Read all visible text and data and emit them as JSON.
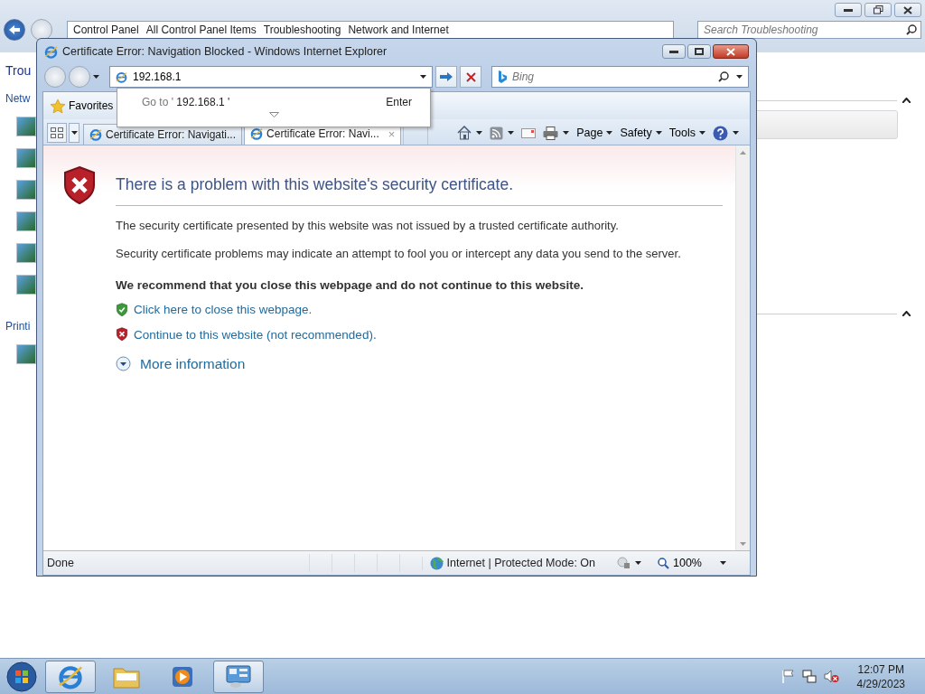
{
  "explorer_window": {
    "breadcrumb": [
      "Control Panel",
      "All Control Panel Items",
      "Troubleshooting",
      "Network and Internet"
    ],
    "search": {
      "placeholder": "Search Troubleshooting"
    },
    "heading": "Trou",
    "sections": [
      {
        "label": "Netw"
      },
      {
        "label": "Printi"
      }
    ]
  },
  "ie_window": {
    "title": "Certificate Error: Navigation Blocked - Windows Internet Explorer",
    "address": {
      "value": "192.168.1"
    },
    "search": {
      "placeholder": "Bing"
    },
    "suggestion": {
      "prefix": "Go to '",
      "text": "192.168.1 '",
      "shortcut": "Enter"
    },
    "favorites": "Favorites",
    "tabs": [
      {
        "label": "Certificate Error: Navigati...",
        "selected": false
      },
      {
        "label": "Certificate Error: Navi...",
        "selected": true,
        "close": "×"
      }
    ],
    "menus": [
      "Page",
      "Safety",
      "Tools"
    ],
    "page": {
      "heading": "There is a problem with this website's security certificate.",
      "paragraphs": [
        "The security certificate presented by this website was not issued by a trusted certificate authority.",
        "Security certificate problems may indicate an attempt to fool you or intercept any data you send to the server."
      ],
      "recommendation": "We recommend that you close this webpage and do not continue to this website.",
      "links": [
        {
          "kind": "safe",
          "text": "Click here to close this webpage."
        },
        {
          "kind": "unsafe",
          "text": "Continue to this website (not recommended)."
        }
      ],
      "more": "More information"
    },
    "status_bar": {
      "text": "Done",
      "zone": "Internet | Protected Mode: On",
      "zoom": "100%"
    }
  },
  "taskbar": {
    "items": [
      {
        "kind": "browser",
        "selected": true
      },
      {
        "kind": "folder",
        "selected": false
      },
      {
        "kind": "media",
        "selected": false
      },
      {
        "kind": "control-panel",
        "selected": true
      }
    ],
    "time": "12:07 PM",
    "date": "4/29/2023"
  }
}
